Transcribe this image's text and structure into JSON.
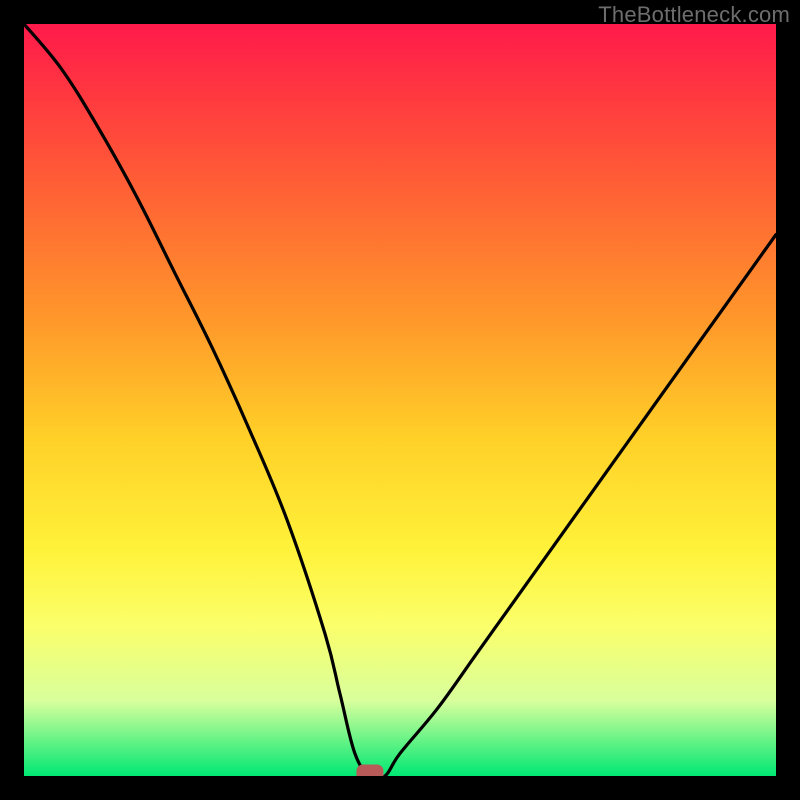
{
  "watermark": "TheBottleneck.com",
  "chart_data": {
    "type": "line",
    "title": "",
    "xlabel": "",
    "ylabel": "",
    "xlim": [
      0,
      100
    ],
    "ylim": [
      0,
      100
    ],
    "series": [
      {
        "name": "bottleneck-curve",
        "x": [
          0,
          5,
          10,
          15,
          20,
          25,
          30,
          35,
          40,
          42,
          44,
          46,
          48,
          50,
          55,
          60,
          65,
          70,
          75,
          80,
          85,
          90,
          95,
          100
        ],
        "values": [
          100,
          94,
          86,
          77,
          67,
          57,
          46,
          34,
          19,
          11,
          3,
          0,
          0,
          3,
          9,
          16,
          23,
          30,
          37,
          44,
          51,
          58,
          65,
          72
        ]
      }
    ],
    "marker_x": 46,
    "marker_y": 0,
    "background": "rainbow-vertical",
    "grid": false,
    "legend": false
  },
  "colors": {
    "frame": "#000000",
    "curve": "#000000",
    "marker": "#b85a58",
    "watermark": "#6d6d6d"
  }
}
